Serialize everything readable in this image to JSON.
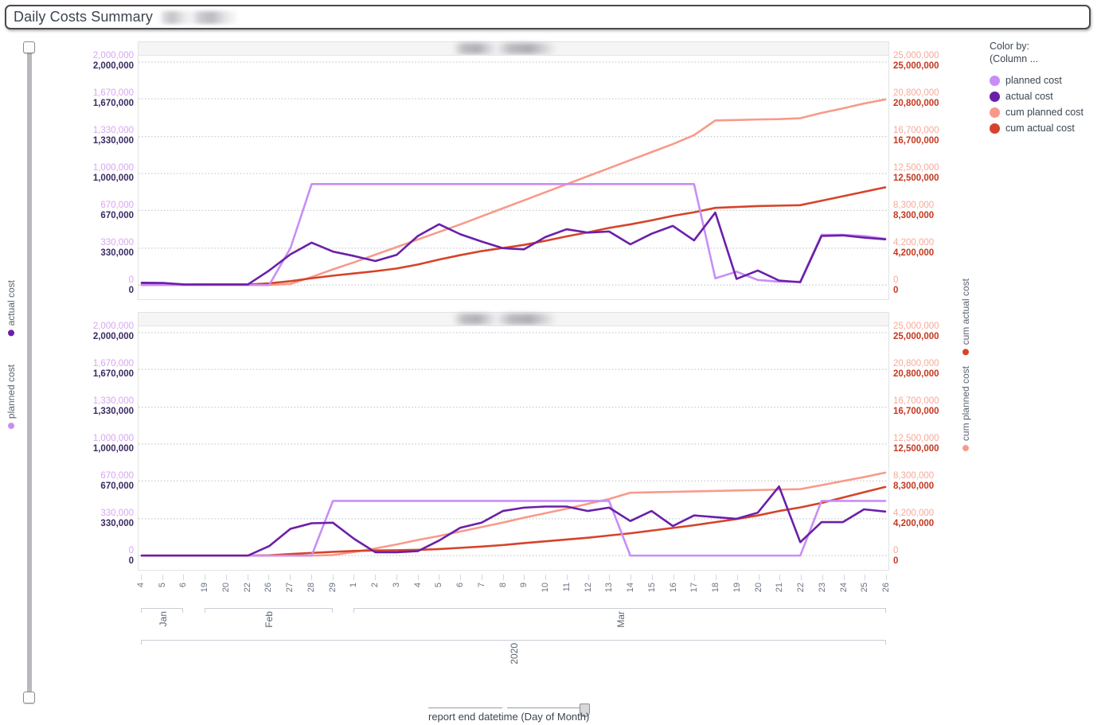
{
  "window": {
    "title": "Daily Costs Summary",
    "title_redacted": true
  },
  "legend": {
    "color_by_line1": "Color by:",
    "color_by_line2": "(Column ...",
    "items": [
      {
        "label": "planned cost",
        "color": "#c88ef5"
      },
      {
        "label": "actual cost",
        "color": "#6a1fa8"
      },
      {
        "label": "cum planned cost",
        "color": "#f89a8a"
      },
      {
        "label": "cum actual cost",
        "color": "#d6432a"
      }
    ]
  },
  "axis_titles": {
    "left_upper": {
      "label": "actual cost",
      "color": "#6a1fa8"
    },
    "left_lower": {
      "label": "planned cost",
      "color": "#c88ef5"
    },
    "right_upper": {
      "label": "cum actual cost",
      "color": "#d6432a"
    },
    "right_lower": {
      "label": "cum planned cost",
      "color": "#f89a8a"
    }
  },
  "slider_vertical": {
    "name": "vertical-scroll-slider"
  },
  "slider_bottom": {
    "label": "report end datetime (Day of Month)"
  },
  "chart_data": {
    "type": "line",
    "title": "Daily Costs Summary",
    "xlabel": "report end datetime (Day of Month)",
    "year_label": "2020",
    "left_axis": {
      "label_upper": "actual cost",
      "label_lower": "planned cost",
      "ticks": [
        "0",
        "330,000",
        "670,000",
        "1,000,000",
        "1,330,000",
        "1,670,000",
        "2,000,000"
      ],
      "ylim": [
        0,
        2000000
      ],
      "color_upper": "#6a1fa8",
      "color_lower": "#c88ef5"
    },
    "right_axis": {
      "label_upper": "cum actual cost",
      "label_lower": "cum planned cost",
      "ticks": [
        "0",
        "4,200,000",
        "8,300,000",
        "12,500,000",
        "16,700,000",
        "20,800,000",
        "25,000,000"
      ],
      "ylim": [
        0,
        25000000
      ],
      "color_upper": "#d6432a",
      "color_lower": "#f89a8a"
    },
    "x_groups": [
      {
        "month": "Jan",
        "days": [
          "4",
          "5",
          "6"
        ]
      },
      {
        "month": "Feb",
        "days": [
          "19",
          "20",
          "22",
          "26",
          "27",
          "28",
          "29"
        ]
      },
      {
        "month": "Mar",
        "days": [
          "1",
          "2",
          "3",
          "4",
          "5",
          "6",
          "7",
          "8",
          "9",
          "10",
          "11",
          "12",
          "13",
          "14",
          "15",
          "16",
          "17",
          "18",
          "19",
          "20",
          "21",
          "22",
          "23",
          "24",
          "25",
          "26"
        ]
      }
    ],
    "x_labels": [
      "4",
      "5",
      "6",
      "19",
      "20",
      "22",
      "26",
      "27",
      "28",
      "29",
      "1",
      "2",
      "3",
      "4",
      "5",
      "6",
      "7",
      "8",
      "9",
      "10",
      "11",
      "12",
      "13",
      "14",
      "15",
      "16",
      "17",
      "18",
      "19",
      "20",
      "21",
      "22",
      "23",
      "24",
      "25",
      "26"
    ],
    "grid": true,
    "legend_position": "right",
    "panels": [
      {
        "name": "panel-top",
        "header_redacted": true,
        "series": [
          {
            "name": "planned cost",
            "color": "#c88ef5",
            "axis": "left",
            "values": [
              0,
              0,
              0,
              0,
              0,
              0,
              0,
              330000,
              905000,
              905000,
              905000,
              905000,
              905000,
              905000,
              905000,
              905000,
              905000,
              905000,
              905000,
              905000,
              905000,
              905000,
              905000,
              905000,
              905000,
              905000,
              905000,
              60000,
              120000,
              45000,
              30000,
              30000,
              450000,
              450000,
              440000,
              415000
            ]
          },
          {
            "name": "actual cost",
            "color": "#6a1fa8",
            "axis": "left",
            "values": [
              20000,
              18000,
              5000,
              5000,
              5000,
              5000,
              130000,
              275000,
              380000,
              300000,
              260000,
              215000,
              270000,
              440000,
              545000,
              455000,
              390000,
              330000,
              320000,
              430000,
              500000,
              470000,
              480000,
              365000,
              460000,
              530000,
              400000,
              650000,
              55000,
              130000,
              40000,
              25000,
              440000,
              445000,
              425000,
              410000
            ]
          },
          {
            "name": "cum planned cost",
            "color": "#f89a8a",
            "axis": "right",
            "values": [
              0,
              0,
              0,
              0,
              0,
              0,
              0,
              120000,
              900000,
              1750000,
              2550000,
              3400000,
              4250000,
              5100000,
              5950000,
              6800000,
              7700000,
              8600000,
              9500000,
              10400000,
              11300000,
              12200000,
              13100000,
              14000000,
              14900000,
              15800000,
              16800000,
              18450000,
              18500000,
              18560000,
              18600000,
              18700000,
              19300000,
              19800000,
              20350000,
              20800000
            ]
          },
          {
            "name": "cum actual cost",
            "color": "#d6432a",
            "axis": "right",
            "values": [
              25000,
              40000,
              45000,
              50000,
              52000,
              55000,
              190000,
              430000,
              760000,
              1050000,
              1300000,
              1550000,
              1850000,
              2300000,
              2850000,
              3350000,
              3800000,
              4150000,
              4500000,
              4950000,
              5450000,
              5900000,
              6400000,
              6800000,
              7250000,
              7750000,
              8150000,
              8650000,
              8750000,
              8850000,
              8900000,
              8950000,
              9450000,
              9950000,
              10450000,
              10950000
            ]
          }
        ]
      },
      {
        "name": "panel-bottom",
        "header_redacted": true,
        "series": [
          {
            "name": "planned cost",
            "color": "#c88ef5",
            "axis": "left",
            "values": [
              0,
              0,
              0,
              0,
              0,
              0,
              0,
              0,
              0,
              490000,
              490000,
              490000,
              490000,
              490000,
              490000,
              490000,
              490000,
              490000,
              490000,
              490000,
              490000,
              490000,
              490000,
              0,
              0,
              0,
              0,
              0,
              0,
              0,
              0,
              0,
              490000,
              490000,
              490000,
              490000
            ]
          },
          {
            "name": "actual cost",
            "color": "#6a1fa8",
            "axis": "left",
            "values": [
              0,
              0,
              0,
              0,
              0,
              0,
              85000,
              240000,
              290000,
              295000,
              150000,
              30000,
              30000,
              40000,
              135000,
              250000,
              295000,
              400000,
              430000,
              440000,
              440000,
              400000,
              430000,
              310000,
              400000,
              265000,
              360000,
              345000,
              330000,
              385000,
              620000,
              120000,
              300000,
              300000,
              415000,
              395000
            ]
          },
          {
            "name": "cum planned cost",
            "color": "#f89a8a",
            "axis": "right",
            "values": [
              0,
              0,
              0,
              0,
              0,
              0,
              0,
              0,
              0,
              60000,
              400000,
              800000,
              1250000,
              1750000,
              2200000,
              2700000,
              3200000,
              3700000,
              4250000,
              4750000,
              5250000,
              5800000,
              6350000,
              7050000,
              7100000,
              7150000,
              7200000,
              7250000,
              7300000,
              7350000,
              7400000,
              7450000,
              7900000,
              8350000,
              8800000,
              9300000
            ]
          },
          {
            "name": "cum actual cost",
            "color": "#d6432a",
            "axis": "right",
            "values": [
              0,
              0,
              0,
              0,
              0,
              0,
              30000,
              170000,
              300000,
              420000,
              520000,
              570000,
              600000,
              640000,
              730000,
              870000,
              1010000,
              1180000,
              1400000,
              1600000,
              1800000,
              2000000,
              2250000,
              2500000,
              2800000,
              3100000,
              3400000,
              3750000,
              4100000,
              4500000,
              5000000,
              5400000,
              5900000,
              6500000,
              7100000,
              7700000
            ]
          }
        ]
      }
    ]
  }
}
